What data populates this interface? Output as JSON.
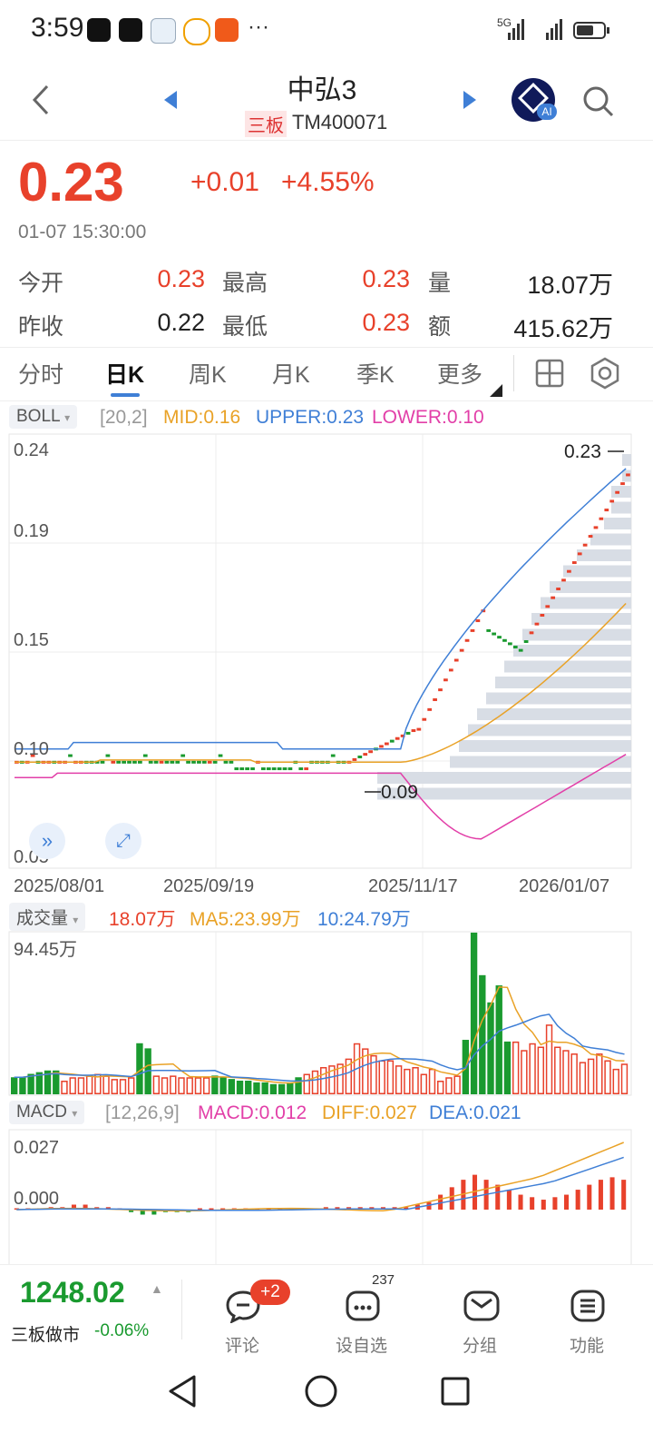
{
  "status": {
    "time": "3:59",
    "signal_label": "5G",
    "icons": [
      "wechat-icon",
      "wifi-icon",
      "shield-icon",
      "browser-icon",
      "app-icon",
      "more-dots-icon",
      "signal-icon",
      "battery-icon"
    ]
  },
  "header": {
    "title": "中弘3",
    "board": "三板",
    "code": "TM400071",
    "icons": [
      "back-icon",
      "prev-arrow-icon",
      "next-arrow-icon",
      "ai-icon",
      "search-icon"
    ],
    "ai_label": "AI"
  },
  "quote": {
    "price": "0.23",
    "change": "+0.01",
    "change_pct": "+4.55%",
    "datetime": "01-07 15:30:00",
    "stats": [
      {
        "label": "今开",
        "value": "0.23"
      },
      {
        "label": "最高",
        "value": "0.23"
      },
      {
        "label": "量",
        "value": "18.07万"
      },
      {
        "label": "昨收",
        "value": "0.22"
      },
      {
        "label": "最低",
        "value": "0.23"
      },
      {
        "label": "额",
        "value": "415.62万"
      }
    ]
  },
  "tabs": {
    "items": [
      "分时",
      "日K",
      "周K",
      "月K",
      "季K",
      "更多"
    ],
    "active": "日K",
    "icons": [
      "grid-icon",
      "settings-icon"
    ]
  },
  "boll": {
    "name": "BOLL",
    "param": "[20,2]",
    "mid": "MID:0.16",
    "upper": "UPPER:0.23",
    "lower": "LOWER:0.10",
    "yticks": [
      "0.24",
      "0.19",
      "0.15",
      "0.10",
      "0.05"
    ],
    "xticks": [
      "2025/08/01",
      "2025/09/19",
      "2025/11/17",
      "2026/01/07"
    ],
    "hi_label": "0.23",
    "lo_label": "0.09"
  },
  "vol": {
    "name": "成交量",
    "value": "18.07万",
    "ma5": "MA5:23.99万",
    "ma10": "10:24.79万",
    "ytop": "94.45万"
  },
  "macd": {
    "name": "MACD",
    "param": "[12,26,9]",
    "macd": "MACD:0.012",
    "diff": "DIFF:0.027",
    "dea": "DEA:0.021",
    "yticks": [
      "0.027",
      "0.000"
    ]
  },
  "bottom": {
    "index_value": "1248.02",
    "index_name": "三板做市",
    "index_change": "-0.06%",
    "comment_label": "评论",
    "comment_badge": "+2",
    "watch_label": "设自选",
    "watch_badge": "237",
    "group_label": "分组",
    "func_label": "功能"
  },
  "colors": {
    "up": "#e8412b",
    "down": "#1a9a2f",
    "mid": "#e9a227",
    "upper": "#3f7fd6",
    "lower": "#e23fa8"
  },
  "chart_data": [
    {
      "type": "line",
      "title": "BOLL",
      "x": [
        "2025/08/01",
        "2025/09/19",
        "2025/11/17",
        "2026/01/07"
      ],
      "ylim": [
        0.05,
        0.24
      ],
      "series": [
        {
          "name": "MID",
          "values": [
            0.094,
            0.096,
            0.095,
            0.16
          ]
        },
        {
          "name": "UPPER",
          "values": [
            0.101,
            0.103,
            0.102,
            0.23
          ]
        },
        {
          "name": "LOWER",
          "values": [
            0.087,
            0.089,
            0.088,
            0.1
          ]
        }
      ]
    },
    {
      "type": "bar",
      "title": "成交量",
      "ylim": [
        0,
        94.45
      ],
      "values": [
        10,
        10,
        12,
        13,
        14,
        14,
        8,
        10,
        10,
        11,
        12,
        11,
        9,
        9,
        10,
        30,
        27,
        11,
        10,
        11,
        10,
        10,
        10,
        10,
        11,
        10,
        9,
        8,
        8,
        7,
        7,
        6,
        6,
        7,
        10,
        12,
        14,
        16,
        17,
        18,
        21,
        30,
        27,
        23,
        20,
        20,
        17,
        15,
        16,
        12,
        15,
        8,
        10,
        11,
        32,
        95,
        70,
        54,
        64,
        31,
        31,
        26,
        30,
        28,
        41,
        28,
        26,
        24,
        19,
        21,
        24,
        20,
        15,
        18
      ]
    },
    {
      "type": "bar",
      "title": "MACD",
      "ylim": [
        -0.004,
        0.027
      ],
      "values": [
        0.0,
        0.0,
        0.0,
        0.001,
        0.001,
        0.002,
        0.002,
        0.001,
        0.001,
        0.0,
        -0.001,
        -0.002,
        -0.002,
        -0.001,
        -0.001,
        -0.001,
        0.0,
        0.0,
        0.0,
        0.0,
        0.0,
        0.0,
        0.0,
        0.0,
        0.0,
        0.0,
        0.0,
        0.001,
        0.001,
        0.001,
        0.001,
        0.001,
        0.001,
        0.001,
        0.001,
        0.002,
        0.003,
        0.006,
        0.009,
        0.012,
        0.014,
        0.012,
        0.01,
        0.008,
        0.006,
        0.005,
        0.004,
        0.005,
        0.006,
        0.008,
        0.01,
        0.012,
        0.013,
        0.012
      ]
    }
  ]
}
